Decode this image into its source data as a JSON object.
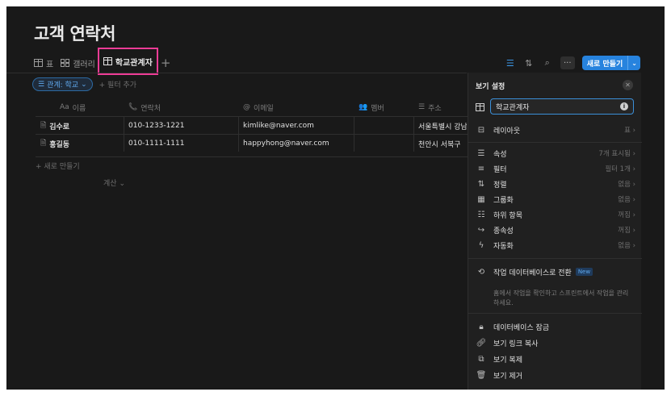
{
  "page": {
    "title": "고객 연락처"
  },
  "tabs": [
    {
      "label": "표",
      "icon": "table-icon"
    },
    {
      "label": "갤러리",
      "icon": "gallery-icon"
    },
    {
      "label": "학교관계자",
      "icon": "table-icon",
      "active": true
    }
  ],
  "toolbar": {
    "new_label": "새로 만들기",
    "accent": "#2783de"
  },
  "filter_bar": {
    "chip_label": "관계: 학교",
    "add_filter": "필터 추가"
  },
  "table": {
    "columns": [
      "이름",
      "연락처",
      "이메일",
      "멤버",
      "주소"
    ],
    "column_icons": [
      "Aa",
      "phone-icon",
      "at-icon",
      "people-icon",
      "lines-icon"
    ],
    "rows": [
      {
        "name": "김수로",
        "phone": "010-1233-1221",
        "email": "kimlike@naver.com",
        "member": "",
        "address": "서울특별시 강남"
      },
      {
        "name": "홍길동",
        "phone": "010-1111-1111",
        "email": "happyhong@naver.com",
        "member": "",
        "address": "천안시 서북구"
      }
    ],
    "new_row": "새로 만들기",
    "calc": "계산"
  },
  "panel": {
    "title": "보기 설정",
    "view_name": "학교관계자",
    "layout_label": "레이아웃",
    "layout_value": "표",
    "items": [
      {
        "label": "속성",
        "value": "7개 표시됨",
        "icon": "list-icon"
      },
      {
        "label": "필터",
        "value": "필터 1개",
        "icon": "filter-icon"
      },
      {
        "label": "정렬",
        "value": "없음",
        "icon": "sort-icon"
      },
      {
        "label": "그룹화",
        "value": "없음",
        "icon": "group-icon"
      },
      {
        "label": "하위 항목",
        "value": "꺼짐",
        "icon": "subitem-icon"
      },
      {
        "label": "종속성",
        "value": "꺼짐",
        "icon": "dependency-icon"
      },
      {
        "label": "자동화",
        "value": "없음",
        "icon": "bolt-icon"
      }
    ],
    "convert_label": "작업 데이터베이스로 전환",
    "convert_badge": "New",
    "convert_desc": "홈에서 작업을 확인하고 스프린트에서 작업을 관리하세요.",
    "actions": [
      {
        "label": "데이터베이스 잠금",
        "icon": "lock-icon"
      },
      {
        "label": "보기 링크 복사",
        "icon": "link-icon"
      },
      {
        "label": "보기 복제",
        "icon": "duplicate-icon"
      },
      {
        "label": "보기 제거",
        "icon": "trash-icon"
      }
    ]
  }
}
